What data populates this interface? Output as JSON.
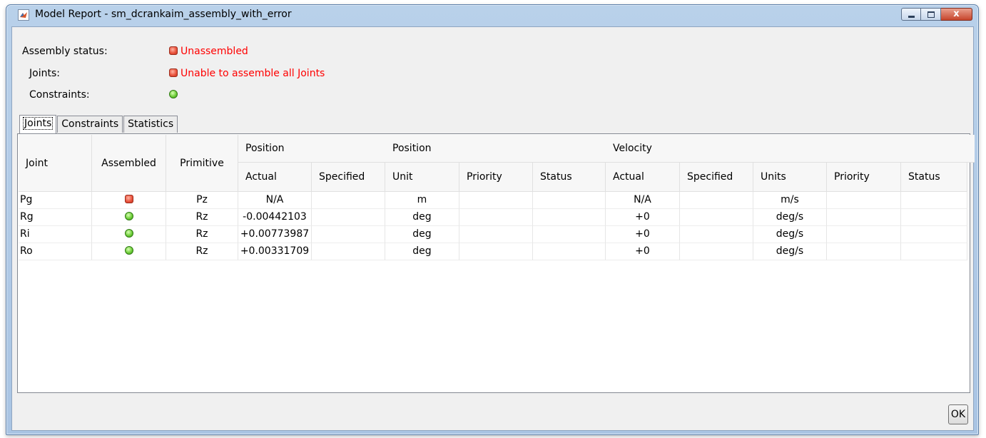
{
  "window": {
    "title": "Model Report - sm_dcrankaim_assembly_with_error",
    "close_glyph": "x",
    "title_icon": "matlab-icon"
  },
  "status": {
    "assembly_label": "Assembly status:",
    "assembly_value": "Unassembled",
    "assembly_indicator": "red",
    "joints_label": "Joints:",
    "joints_value": "Unable to assemble all Joints",
    "joints_indicator": "red",
    "constraints_label": "Constraints:",
    "constraints_value": "",
    "constraints_indicator": "green"
  },
  "tabs": [
    {
      "label": "Joints",
      "active": true
    },
    {
      "label": "Constraints",
      "active": false
    },
    {
      "label": "Statistics",
      "active": false
    }
  ],
  "table": {
    "headers": {
      "joint": "Joint",
      "assembled": "Assembled",
      "primitive": "Primitive",
      "position_group_1": "Position",
      "position_group_2": "Position",
      "velocity_group": "Velocity",
      "sub": [
        "Actual",
        "Specified",
        "Unit",
        "Priority",
        "Status",
        "Actual",
        "Specified",
        "Units",
        "Priority",
        "Status"
      ]
    },
    "rows": [
      {
        "joint": "Pg",
        "assembled": "red",
        "primitive": "Pz",
        "pos_actual": "N/A",
        "pos_specified": "",
        "pos_unit": "m",
        "pos_priority": "",
        "pos_status": "",
        "vel_actual": "N/A",
        "vel_specified": "",
        "vel_units": "m/s",
        "vel_priority": "",
        "vel_status": ""
      },
      {
        "joint": "Rg",
        "assembled": "green",
        "primitive": "Rz",
        "pos_actual": "-0.00442103",
        "pos_specified": "",
        "pos_unit": "deg",
        "pos_priority": "",
        "pos_status": "",
        "vel_actual": "+0",
        "vel_specified": "",
        "vel_units": "deg/s",
        "vel_priority": "",
        "vel_status": ""
      },
      {
        "joint": "Ri",
        "assembled": "green",
        "primitive": "Rz",
        "pos_actual": "+0.00773987",
        "pos_specified": "",
        "pos_unit": "deg",
        "pos_priority": "",
        "pos_status": "",
        "vel_actual": "+0",
        "vel_specified": "",
        "vel_units": "deg/s",
        "vel_priority": "",
        "vel_status": ""
      },
      {
        "joint": "Ro",
        "assembled": "green",
        "primitive": "Rz",
        "pos_actual": "+0.00331709",
        "pos_specified": "",
        "pos_unit": "deg",
        "pos_priority": "",
        "pos_status": "",
        "vel_actual": "+0",
        "vel_specified": "",
        "vel_units": "deg/s",
        "vel_priority": "",
        "vel_status": ""
      }
    ]
  },
  "buttons": {
    "ok_label": "OK"
  },
  "colors": {
    "error_text": "#ff0000",
    "led_red": "#e8503a",
    "led_green": "#6fce3a"
  }
}
